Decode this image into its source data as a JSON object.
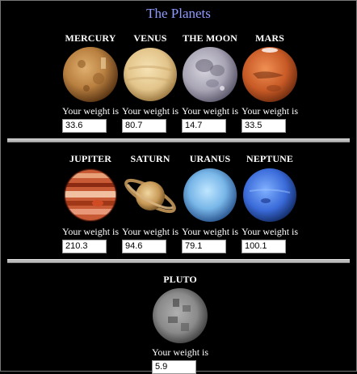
{
  "page": {
    "title": "The Planets"
  },
  "weight_label": "Your weight is",
  "planets": [
    {
      "name": "MERCURY",
      "weight": "33.6"
    },
    {
      "name": "VENUS",
      "weight": "80.7"
    },
    {
      "name": "THE MOON",
      "weight": "14.7"
    },
    {
      "name": "MARS",
      "weight": "33.5"
    },
    {
      "name": "JUPITER",
      "weight": "210.3"
    },
    {
      "name": "SATURN",
      "weight": "94.6"
    },
    {
      "name": "URANUS",
      "weight": "79.1"
    },
    {
      "name": "NEPTUNE",
      "weight": "100.1"
    },
    {
      "name": "PLUTO",
      "weight": "5.9"
    }
  ],
  "colors": {
    "background": "#000000",
    "title": "#8f9bff",
    "text": "#ffffff"
  }
}
